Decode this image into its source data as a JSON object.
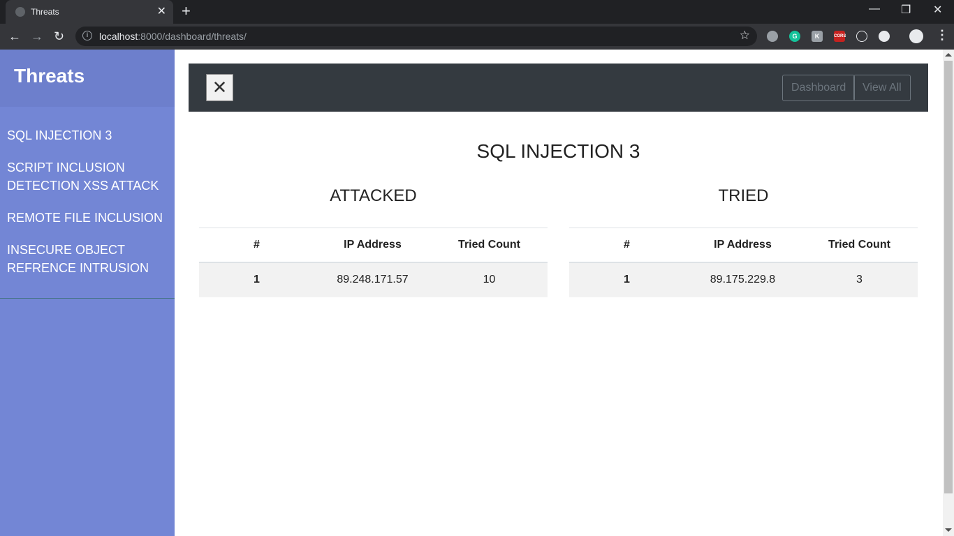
{
  "browser": {
    "tab_title": "Threats",
    "tab_close": "✕",
    "new_tab": "+",
    "minimize": "—",
    "restore": "❐",
    "close": "✕",
    "back": "←",
    "forward": "→",
    "reload": "↻",
    "url_host": "localhost",
    "url_rest": ":8000/dashboard/threats/",
    "star": "☆",
    "extensions": [
      "globe",
      "G",
      "K",
      "CORS",
      "react",
      "ext"
    ]
  },
  "sidebar": {
    "title": "Threats",
    "items": [
      {
        "label": "SQL INJECTION 3"
      },
      {
        "label": "SCRIPT INCLUSION DETECTION XSS ATTACK"
      },
      {
        "label": "REMOTE FILE INCLUSION"
      },
      {
        "label": "INSECURE OBJECT REFRENCE INTRUSION"
      }
    ]
  },
  "topnav": {
    "toggle_label": "✕",
    "links": [
      {
        "label": "Dashboard"
      },
      {
        "label": "View All"
      }
    ]
  },
  "main": {
    "title": "SQL INJECTION 3",
    "attacked": {
      "title": "ATTACKED",
      "columns": [
        "#",
        "IP Address",
        "Tried Count"
      ],
      "rows": [
        [
          "1",
          "89.248.171.57",
          "10"
        ]
      ]
    },
    "tried": {
      "title": "TRIED",
      "columns": [
        "#",
        "IP Address",
        "Tried Count"
      ],
      "rows": [
        [
          "1",
          "89.175.229.8",
          "3"
        ]
      ]
    }
  },
  "colors": {
    "sidebar_bg": "#7386d5",
    "sidebar_header_bg": "#6d7fcc",
    "topnav_bg": "#343a40",
    "row_bg": "#f2f2f2"
  }
}
